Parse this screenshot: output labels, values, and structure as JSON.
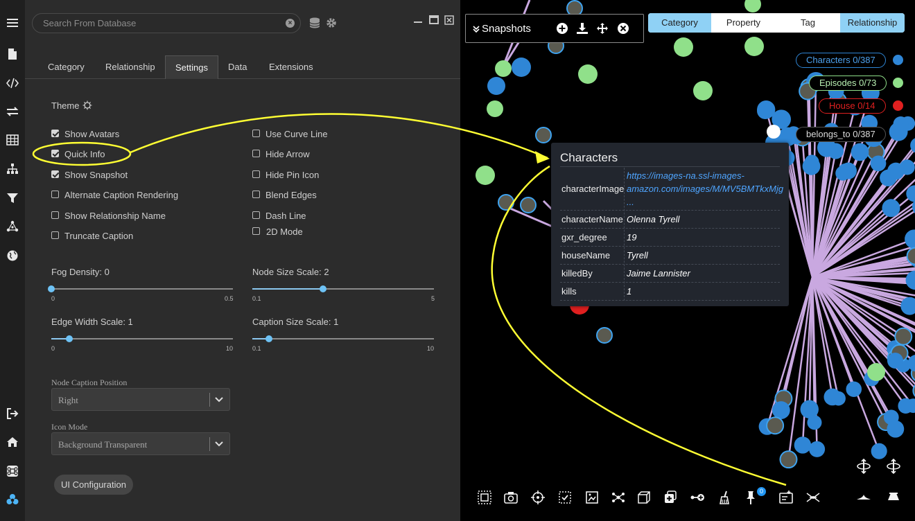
{
  "search": {
    "placeholder": "Search From Database"
  },
  "tabs": [
    {
      "label": "Category"
    },
    {
      "label": "Relationship"
    },
    {
      "label": "Settings",
      "active": true
    },
    {
      "label": "Data"
    },
    {
      "label": "Extensions"
    }
  ],
  "settings": {
    "theme_label": "Theme",
    "checkboxes_left": [
      {
        "label": "Show Avatars",
        "checked": true
      },
      {
        "label": "Quick Info",
        "checked": true
      },
      {
        "label": "Show Snapshot",
        "checked": true
      },
      {
        "label": "Alternate Caption Rendering",
        "checked": false
      },
      {
        "label": "Show Relationship Name",
        "checked": false
      },
      {
        "label": "Truncate Caption",
        "checked": false
      }
    ],
    "checkboxes_right": [
      {
        "label": "Use Curve Line",
        "checked": false
      },
      {
        "label": "Hide Arrow",
        "checked": false
      },
      {
        "label": "Hide Pin Icon",
        "checked": false
      },
      {
        "label": "Blend Edges",
        "checked": false
      },
      {
        "label": "Dash Line",
        "checked": false
      },
      {
        "label": "2D Mode",
        "checked": false
      }
    ],
    "sliders": [
      {
        "label": "Fog Density: 0",
        "min": "0",
        "max": "0.5",
        "fraction": 0
      },
      {
        "label": "Node Size Scale: 2",
        "min": "0.1",
        "max": "5",
        "fraction": 0.39
      },
      {
        "label": "Edge Width Scale: 1",
        "min": "0",
        "max": "10",
        "fraction": 0.1
      },
      {
        "label": "Caption Size Scale: 1",
        "min": "0.1",
        "max": "10",
        "fraction": 0.09
      }
    ],
    "node_caption_position": {
      "label": "Node Caption Position",
      "value": "Right"
    },
    "icon_mode": {
      "label": "Icon Mode",
      "value": "Background Transparent"
    },
    "ui_config_button": "UI Configuration"
  },
  "snapshots": {
    "title": "Snapshots"
  },
  "filter_tabs": [
    {
      "label": "Category",
      "active": true
    },
    {
      "label": "Property",
      "active": false
    },
    {
      "label": "Tag",
      "active": false
    },
    {
      "label": "Relationship",
      "active": true
    }
  ],
  "legend": [
    {
      "label": "Characters 0/387",
      "color": "#2f86d6"
    },
    {
      "label": "Episodes 0/73",
      "color": "#90e08a"
    },
    {
      "label": "House 0/14",
      "color": "#e02020"
    },
    {
      "label": "belongs_to 0/387",
      "color": "#c9a8e0"
    }
  ],
  "quick_info": {
    "title": "Characters",
    "rows": [
      {
        "key": "characterImage",
        "value": "https://images-na.ssl-images-amazon.com/images/M/MV5BMTkxMjg ..."
      },
      {
        "key": "characterName",
        "value": "Olenna Tyrell"
      },
      {
        "key": "gxr_degree",
        "value": "19"
      },
      {
        "key": "houseName",
        "value": "Tyrell"
      },
      {
        "key": "killedBy",
        "value": "Jaime Lannister"
      },
      {
        "key": "kills",
        "value": "1"
      }
    ]
  },
  "pin_badge": "0",
  "colors": {
    "accent": "#8fd1f5",
    "character_node": "#2f86d6",
    "episode_node": "#90e08a",
    "house_node": "#e02020",
    "edge": "#c9a8e0",
    "annotation": "#ffff33"
  }
}
